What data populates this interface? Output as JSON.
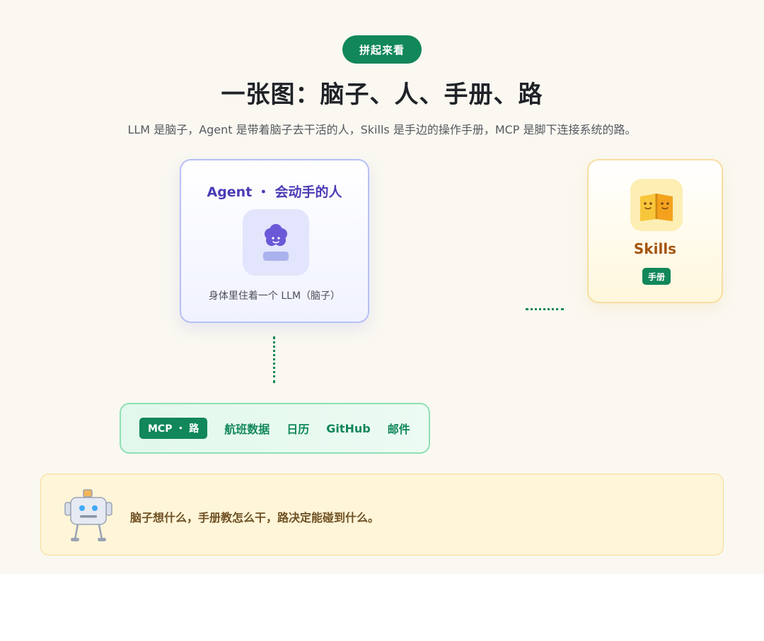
{
  "header": {
    "pill": "拼起来看",
    "title": "一张图：脑子、人、手册、路",
    "subtitle": "LLM 是脑子，Agent 是带着脑子去干活的人，Skills 是手边的操作手册，MCP 是脚下连接系统的路。"
  },
  "agent": {
    "title": "Agent ・ 会动手的人",
    "caption": "身体里住着一个 LLM（脑子）",
    "icon": "person-icon"
  },
  "skills": {
    "title": "Skills",
    "badge": "手册",
    "icon": "open-book-icon"
  },
  "mcp": {
    "tag": "MCP ・ 路",
    "items": [
      "航班数据",
      "日历",
      "GitHub",
      "邮件"
    ]
  },
  "note": {
    "text": "脑子想什么，手册教怎么干，路决定能碰到什么。",
    "icon": "robot-icon"
  },
  "colors": {
    "accent_green": "#11875a",
    "agent_purple": "#4a3bb5",
    "skills_brown": "#a55410",
    "background": "#faf8f1"
  }
}
